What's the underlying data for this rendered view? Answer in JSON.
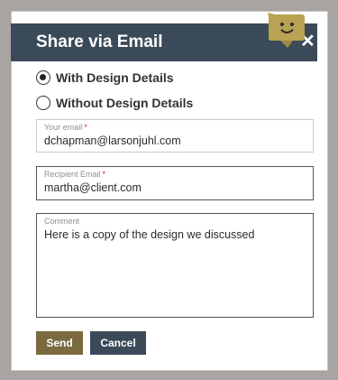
{
  "modal": {
    "title": "Share via Email"
  },
  "options": [
    {
      "label": "With Design Details",
      "selected": true
    },
    {
      "label": "Without Design Details",
      "selected": false
    }
  ],
  "fields": {
    "your_email": {
      "label": "Your email",
      "value": "dchapman@larsonjuhl.com",
      "required_mark": "*"
    },
    "recipient_email": {
      "label": "Recipient Email",
      "value": "martha@client.com",
      "required_mark": "*"
    },
    "comment": {
      "label": "Comment",
      "value": "Here is a copy of the design we discussed"
    }
  },
  "buttons": {
    "send": "Send",
    "cancel": "Cancel"
  },
  "colors": {
    "header": "#3b4a59",
    "send_button": "#7a6a3e",
    "cancel_button": "#3b4a59",
    "required": "#d9262b",
    "backdrop": "#a8a4a2"
  },
  "icons": {
    "close": "close-icon",
    "mascot": "chat-mascot-icon"
  }
}
